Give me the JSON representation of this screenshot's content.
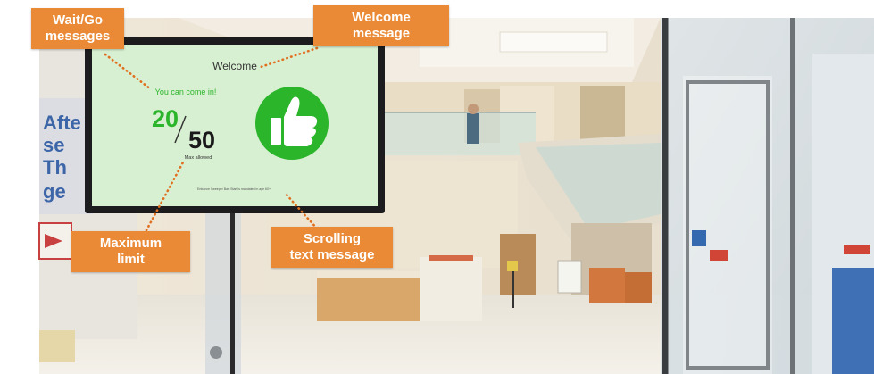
{
  "sign": {
    "welcome_text": "Welcome",
    "status_message": "You can come in!",
    "current_count": "20",
    "max_count": "50",
    "max_label": "Max allowed",
    "scrolling_text": "Entrance Sweeper Bart Start is mandated in age 60+",
    "status_icon": "thumbs-up-icon",
    "background_color": "#d8f0d2",
    "accent_color": "#2bb52b"
  },
  "callouts": {
    "wait_go": {
      "line1": "Wait/Go",
      "line2": "messages"
    },
    "welcome": {
      "line1": "Welcome",
      "line2": "message"
    },
    "maximum": {
      "line1": "Maximum",
      "line2": "limit"
    },
    "scrolling": {
      "line1": "Scrolling",
      "line2": "text message"
    }
  },
  "colors": {
    "callout_bg": "#ea8a36",
    "leader_line": "#e07020"
  }
}
